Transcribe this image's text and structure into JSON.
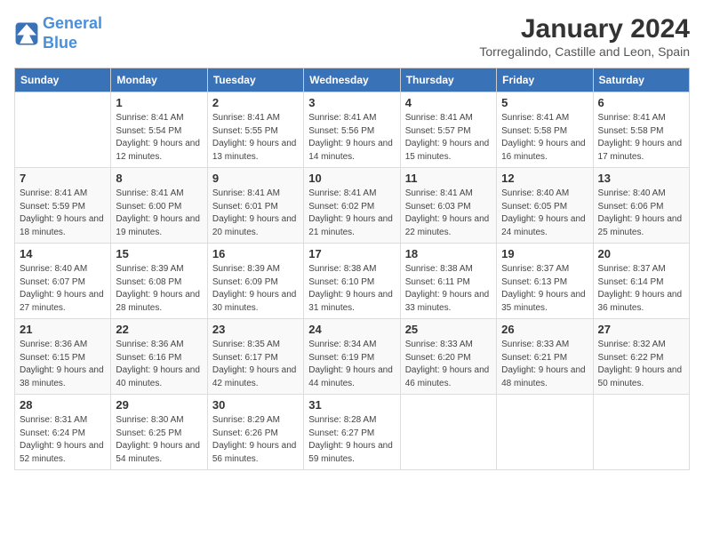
{
  "header": {
    "logo_line1": "General",
    "logo_line2": "Blue",
    "month": "January 2024",
    "location": "Torregalindo, Castille and Leon, Spain"
  },
  "weekdays": [
    "Sunday",
    "Monday",
    "Tuesday",
    "Wednesday",
    "Thursday",
    "Friday",
    "Saturday"
  ],
  "weeks": [
    [
      {
        "day": "",
        "sunrise": "",
        "sunset": "",
        "daylight": ""
      },
      {
        "day": "1",
        "sunrise": "Sunrise: 8:41 AM",
        "sunset": "Sunset: 5:54 PM",
        "daylight": "Daylight: 9 hours and 12 minutes."
      },
      {
        "day": "2",
        "sunrise": "Sunrise: 8:41 AM",
        "sunset": "Sunset: 5:55 PM",
        "daylight": "Daylight: 9 hours and 13 minutes."
      },
      {
        "day": "3",
        "sunrise": "Sunrise: 8:41 AM",
        "sunset": "Sunset: 5:56 PM",
        "daylight": "Daylight: 9 hours and 14 minutes."
      },
      {
        "day": "4",
        "sunrise": "Sunrise: 8:41 AM",
        "sunset": "Sunset: 5:57 PM",
        "daylight": "Daylight: 9 hours and 15 minutes."
      },
      {
        "day": "5",
        "sunrise": "Sunrise: 8:41 AM",
        "sunset": "Sunset: 5:58 PM",
        "daylight": "Daylight: 9 hours and 16 minutes."
      },
      {
        "day": "6",
        "sunrise": "Sunrise: 8:41 AM",
        "sunset": "Sunset: 5:58 PM",
        "daylight": "Daylight: 9 hours and 17 minutes."
      }
    ],
    [
      {
        "day": "7",
        "sunrise": "Sunrise: 8:41 AM",
        "sunset": "Sunset: 5:59 PM",
        "daylight": "Daylight: 9 hours and 18 minutes."
      },
      {
        "day": "8",
        "sunrise": "Sunrise: 8:41 AM",
        "sunset": "Sunset: 6:00 PM",
        "daylight": "Daylight: 9 hours and 19 minutes."
      },
      {
        "day": "9",
        "sunrise": "Sunrise: 8:41 AM",
        "sunset": "Sunset: 6:01 PM",
        "daylight": "Daylight: 9 hours and 20 minutes."
      },
      {
        "day": "10",
        "sunrise": "Sunrise: 8:41 AM",
        "sunset": "Sunset: 6:02 PM",
        "daylight": "Daylight: 9 hours and 21 minutes."
      },
      {
        "day": "11",
        "sunrise": "Sunrise: 8:41 AM",
        "sunset": "Sunset: 6:03 PM",
        "daylight": "Daylight: 9 hours and 22 minutes."
      },
      {
        "day": "12",
        "sunrise": "Sunrise: 8:40 AM",
        "sunset": "Sunset: 6:05 PM",
        "daylight": "Daylight: 9 hours and 24 minutes."
      },
      {
        "day": "13",
        "sunrise": "Sunrise: 8:40 AM",
        "sunset": "Sunset: 6:06 PM",
        "daylight": "Daylight: 9 hours and 25 minutes."
      }
    ],
    [
      {
        "day": "14",
        "sunrise": "Sunrise: 8:40 AM",
        "sunset": "Sunset: 6:07 PM",
        "daylight": "Daylight: 9 hours and 27 minutes."
      },
      {
        "day": "15",
        "sunrise": "Sunrise: 8:39 AM",
        "sunset": "Sunset: 6:08 PM",
        "daylight": "Daylight: 9 hours and 28 minutes."
      },
      {
        "day": "16",
        "sunrise": "Sunrise: 8:39 AM",
        "sunset": "Sunset: 6:09 PM",
        "daylight": "Daylight: 9 hours and 30 minutes."
      },
      {
        "day": "17",
        "sunrise": "Sunrise: 8:38 AM",
        "sunset": "Sunset: 6:10 PM",
        "daylight": "Daylight: 9 hours and 31 minutes."
      },
      {
        "day": "18",
        "sunrise": "Sunrise: 8:38 AM",
        "sunset": "Sunset: 6:11 PM",
        "daylight": "Daylight: 9 hours and 33 minutes."
      },
      {
        "day": "19",
        "sunrise": "Sunrise: 8:37 AM",
        "sunset": "Sunset: 6:13 PM",
        "daylight": "Daylight: 9 hours and 35 minutes."
      },
      {
        "day": "20",
        "sunrise": "Sunrise: 8:37 AM",
        "sunset": "Sunset: 6:14 PM",
        "daylight": "Daylight: 9 hours and 36 minutes."
      }
    ],
    [
      {
        "day": "21",
        "sunrise": "Sunrise: 8:36 AM",
        "sunset": "Sunset: 6:15 PM",
        "daylight": "Daylight: 9 hours and 38 minutes."
      },
      {
        "day": "22",
        "sunrise": "Sunrise: 8:36 AM",
        "sunset": "Sunset: 6:16 PM",
        "daylight": "Daylight: 9 hours and 40 minutes."
      },
      {
        "day": "23",
        "sunrise": "Sunrise: 8:35 AM",
        "sunset": "Sunset: 6:17 PM",
        "daylight": "Daylight: 9 hours and 42 minutes."
      },
      {
        "day": "24",
        "sunrise": "Sunrise: 8:34 AM",
        "sunset": "Sunset: 6:19 PM",
        "daylight": "Daylight: 9 hours and 44 minutes."
      },
      {
        "day": "25",
        "sunrise": "Sunrise: 8:33 AM",
        "sunset": "Sunset: 6:20 PM",
        "daylight": "Daylight: 9 hours and 46 minutes."
      },
      {
        "day": "26",
        "sunrise": "Sunrise: 8:33 AM",
        "sunset": "Sunset: 6:21 PM",
        "daylight": "Daylight: 9 hours and 48 minutes."
      },
      {
        "day": "27",
        "sunrise": "Sunrise: 8:32 AM",
        "sunset": "Sunset: 6:22 PM",
        "daylight": "Daylight: 9 hours and 50 minutes."
      }
    ],
    [
      {
        "day": "28",
        "sunrise": "Sunrise: 8:31 AM",
        "sunset": "Sunset: 6:24 PM",
        "daylight": "Daylight: 9 hours and 52 minutes."
      },
      {
        "day": "29",
        "sunrise": "Sunrise: 8:30 AM",
        "sunset": "Sunset: 6:25 PM",
        "daylight": "Daylight: 9 hours and 54 minutes."
      },
      {
        "day": "30",
        "sunrise": "Sunrise: 8:29 AM",
        "sunset": "Sunset: 6:26 PM",
        "daylight": "Daylight: 9 hours and 56 minutes."
      },
      {
        "day": "31",
        "sunrise": "Sunrise: 8:28 AM",
        "sunset": "Sunset: 6:27 PM",
        "daylight": "Daylight: 9 hours and 59 minutes."
      },
      {
        "day": "",
        "sunrise": "",
        "sunset": "",
        "daylight": ""
      },
      {
        "day": "",
        "sunrise": "",
        "sunset": "",
        "daylight": ""
      },
      {
        "day": "",
        "sunrise": "",
        "sunset": "",
        "daylight": ""
      }
    ]
  ]
}
